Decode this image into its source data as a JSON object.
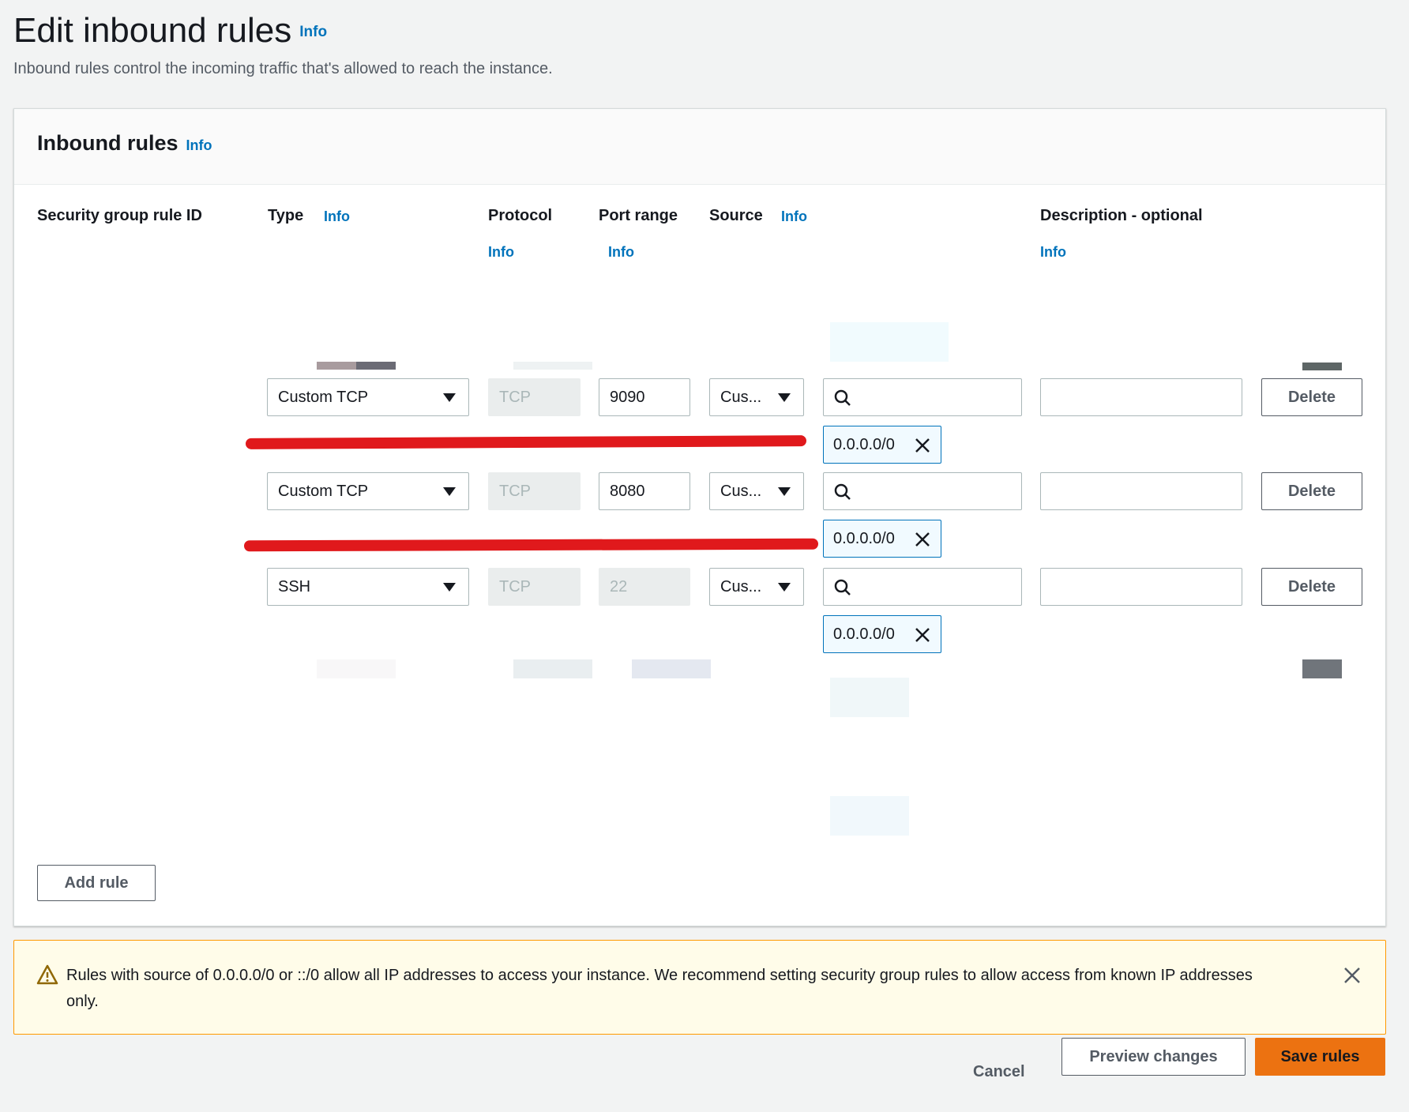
{
  "page": {
    "title": "Edit inbound rules",
    "title_info": "Info",
    "description": "Inbound rules control the incoming traffic that's allowed to reach the instance."
  },
  "panel": {
    "title": "Inbound rules",
    "title_info": "Info",
    "columns": {
      "rule_id": "Security group rule ID",
      "type": "Type",
      "type_info": "Info",
      "protocol": "Protocol",
      "protocol_info": "Info",
      "port_range": "Port range",
      "port_range_info": "Info",
      "source": "Source",
      "source_info": "Info",
      "description": "Description - optional",
      "description_info": "Info"
    },
    "rules": [
      {
        "type": "Custom TCP",
        "protocol": "TCP",
        "port": "9090",
        "source_select": "Cus...",
        "search_value": "",
        "cidr": "0.0.0.0/0",
        "description": "",
        "delete_label": "Delete"
      },
      {
        "type": "Custom TCP",
        "protocol": "TCP",
        "port": "8080",
        "source_select": "Cus...",
        "search_value": "",
        "cidr": "0.0.0.0/0",
        "description": "",
        "delete_label": "Delete"
      },
      {
        "type": "SSH",
        "protocol": "TCP",
        "port": "22",
        "source_select": "Cus...",
        "search_value": "",
        "cidr": "0.0.0.0/0",
        "description": "",
        "delete_label": "Delete"
      }
    ],
    "add_rule_label": "Add rule"
  },
  "alert": {
    "text": "Rules with source of 0.0.0.0/0 or ::/0 allow all IP addresses to access your instance. We recommend setting security group rules to allow access from known IP addresses only."
  },
  "footer": {
    "cancel_label": "Cancel",
    "preview_label": "Preview changes",
    "save_label": "Save rules"
  },
  "colors": {
    "accent": "#0073bb",
    "primary_button": "#ec7211",
    "warning_border": "#ff9900",
    "warning_bg": "#fffce9",
    "redaction_mark": "#e0191c"
  }
}
